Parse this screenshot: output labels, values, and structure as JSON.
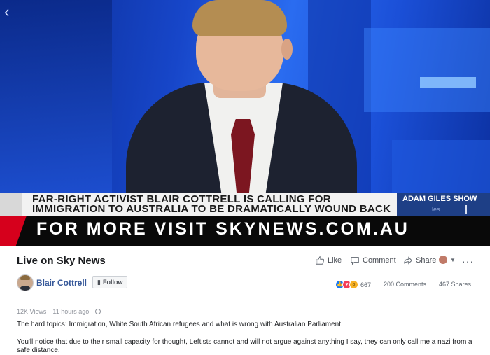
{
  "video": {
    "headline_line1": "FAR-RIGHT ACTIVIST BLAIR COTTRELL IS CALLING FOR",
    "headline_line2": "IMMIGRATION TO AUSTRALIA TO BE DRAMATICALLY WOUND BACK",
    "show_name": "ADAM GILES SHOW",
    "show_sub": "les",
    "promo": "FOR MORE VISIT SKYNEWS.COM.AU",
    "back_icon": "chevron-left-icon"
  },
  "post": {
    "title": "Live on Sky News",
    "actions": {
      "like": "Like",
      "comment": "Comment",
      "share": "Share"
    },
    "page_name": "Blair Cottrell",
    "follow_label": "Follow",
    "reaction_count": "667",
    "comments_count": "200 Comments",
    "shares_count": "467 Shares",
    "views": "12K Views",
    "separator": "·",
    "time": "11 hours ago",
    "paragraph1": "The hard topics: Immigration, White South African refugees and what is wrong with Australian Parliament.",
    "paragraph2": "You'll notice that due to their small capacity for thought, Leftists cannot and will not argue against anything I say, they can only call me a nazi from a safe distance."
  },
  "colors": {
    "link": "#365899",
    "like_reaction": "#1877f2",
    "love_reaction": "#f33e58",
    "wow_reaction": "#f7b125",
    "promo_red": "#d6001c",
    "show_tag_bg": "#1e3f86"
  }
}
